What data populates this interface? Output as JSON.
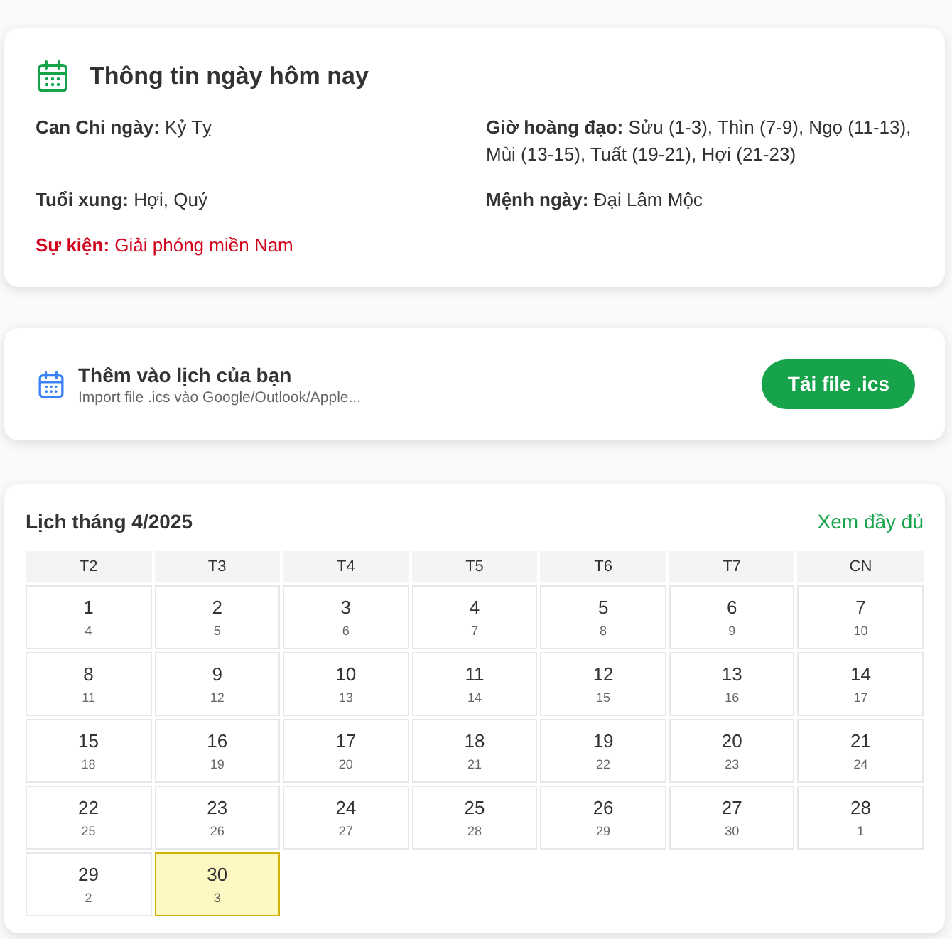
{
  "today_info": {
    "title": "Thông tin ngày hôm nay",
    "fields": [
      {
        "kind": "info",
        "text": "**Can Chi ngày:** Kỷ Tỵ"
      },
      {
        "kind": "info",
        "text": "**Giờ hoàng đạo:** Sửu (1-3), Thìn (7-9), Ngọ (11-13), Mùi (13-15), Tuất (19-21), Hợi (21-23)"
      },
      {
        "kind": "info",
        "text": "**Tuổi xung:** Hợi, Quý"
      },
      {
        "kind": "info",
        "text": "**Mệnh ngày:** Đại Lâm Mộc"
      },
      {
        "kind": "event",
        "text": "**Sự kiện:** Giải phóng miền Nam"
      }
    ]
  },
  "add_to_calendar": {
    "title": "Thêm vào lịch của bạn",
    "subtitle": "Import file .ics vào Google/Outlook/Apple...",
    "button": "Tải file .ics"
  },
  "month_calendar": {
    "title": "Lịch tháng 4/2025",
    "link": "Xem đầy đủ",
    "weekdays": [
      "T2",
      "T3",
      "T4",
      "T5",
      "T6",
      "T7",
      "CN"
    ],
    "days": [
      {
        "solar": "1",
        "lunar": "4",
        "selected": false
      },
      {
        "solar": "2",
        "lunar": "5",
        "selected": false
      },
      {
        "solar": "3",
        "lunar": "6",
        "selected": false
      },
      {
        "solar": "4",
        "lunar": "7",
        "selected": false
      },
      {
        "solar": "5",
        "lunar": "8",
        "selected": false
      },
      {
        "solar": "6",
        "lunar": "9",
        "selected": false
      },
      {
        "solar": "7",
        "lunar": "10",
        "selected": false
      },
      {
        "solar": "8",
        "lunar": "11",
        "selected": false
      },
      {
        "solar": "9",
        "lunar": "12",
        "selected": false
      },
      {
        "solar": "10",
        "lunar": "13",
        "selected": false
      },
      {
        "solar": "11",
        "lunar": "14",
        "selected": false
      },
      {
        "solar": "12",
        "lunar": "15",
        "selected": false
      },
      {
        "solar": "13",
        "lunar": "16",
        "selected": false
      },
      {
        "solar": "14",
        "lunar": "17",
        "selected": false
      },
      {
        "solar": "15",
        "lunar": "18",
        "selected": false
      },
      {
        "solar": "16",
        "lunar": "19",
        "selected": false
      },
      {
        "solar": "17",
        "lunar": "20",
        "selected": false
      },
      {
        "solar": "18",
        "lunar": "21",
        "selected": false
      },
      {
        "solar": "19",
        "lunar": "22",
        "selected": false
      },
      {
        "solar": "20",
        "lunar": "23",
        "selected": false
      },
      {
        "solar": "21",
        "lunar": "24",
        "selected": false
      },
      {
        "solar": "22",
        "lunar": "25",
        "selected": false
      },
      {
        "solar": "23",
        "lunar": "26",
        "selected": false
      },
      {
        "solar": "24",
        "lunar": "27",
        "selected": false
      },
      {
        "solar": "25",
        "lunar": "28",
        "selected": false
      },
      {
        "solar": "26",
        "lunar": "29",
        "selected": false
      },
      {
        "solar": "27",
        "lunar": "30",
        "selected": false
      },
      {
        "solar": "28",
        "lunar": "1",
        "selected": false
      },
      {
        "solar": "29",
        "lunar": "2",
        "selected": false
      },
      {
        "solar": "30",
        "lunar": "3",
        "selected": true
      }
    ]
  }
}
